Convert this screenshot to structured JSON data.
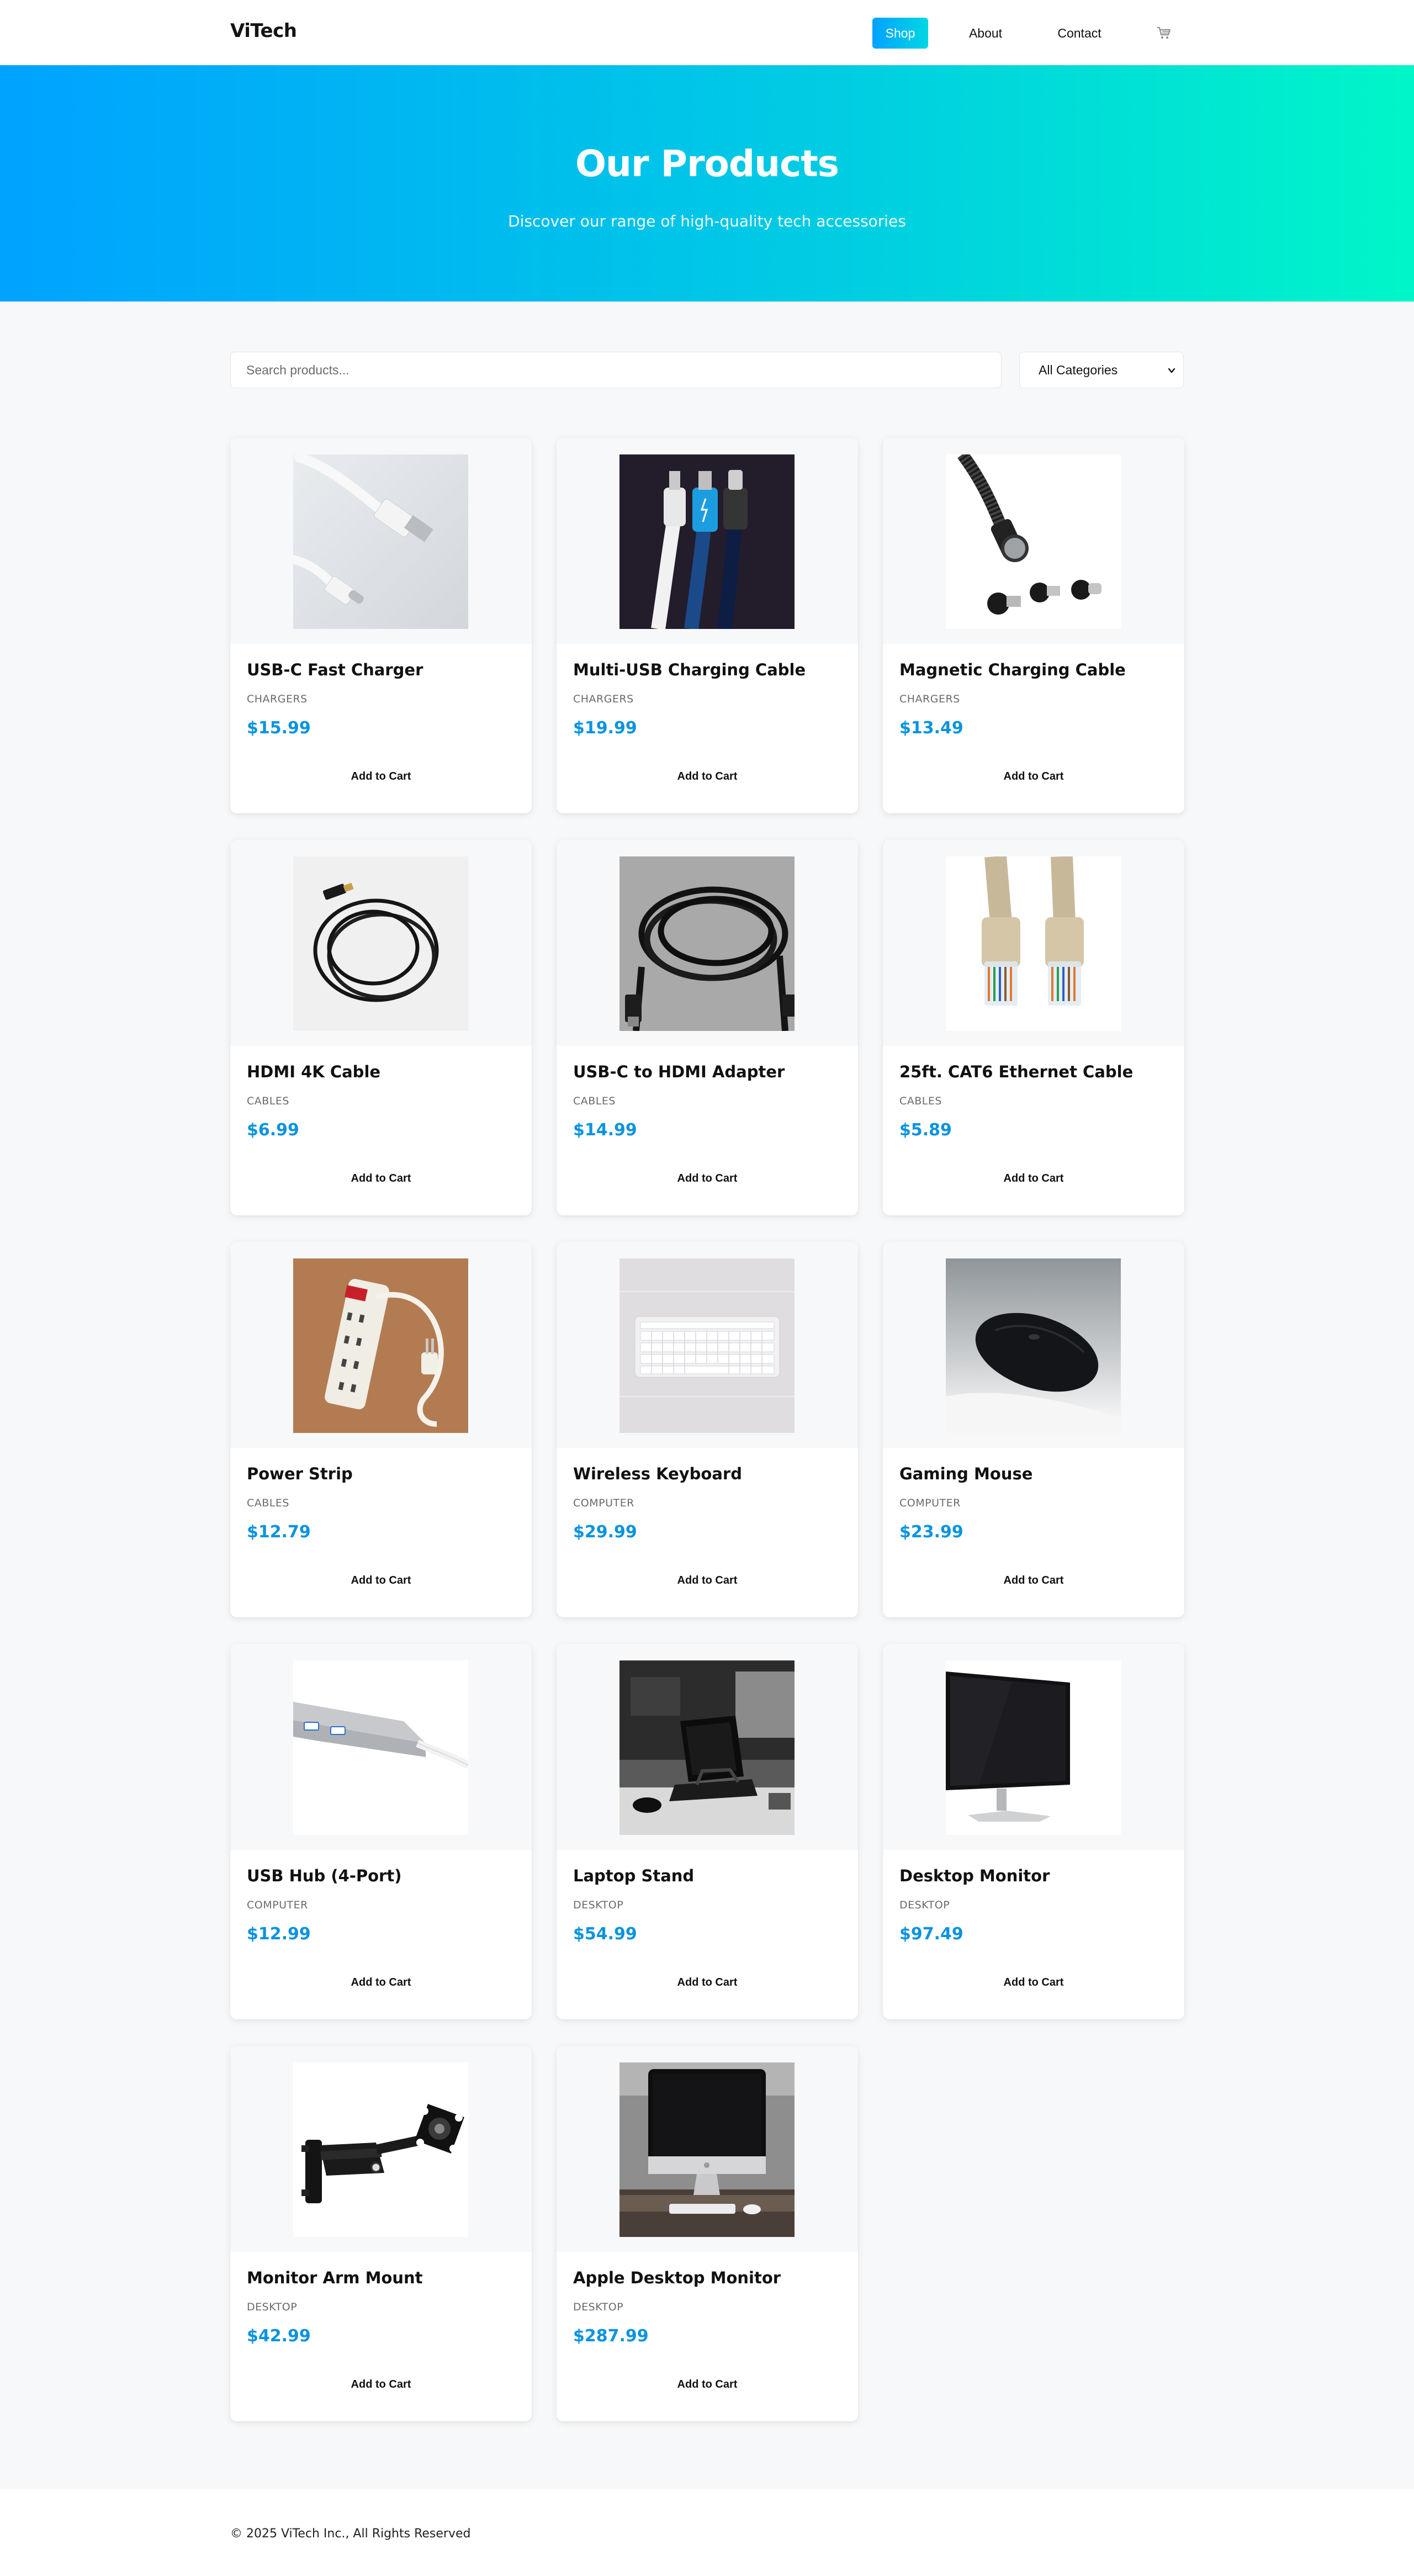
{
  "brand": {
    "logo": "ViTech"
  },
  "nav": {
    "items": [
      {
        "label": "Shop",
        "active": true
      },
      {
        "label": "About",
        "active": false
      },
      {
        "label": "Contact",
        "active": false
      }
    ],
    "cart_icon": "cart-icon"
  },
  "hero": {
    "title": "Our Products",
    "subtitle": "Discover our range of high-quality tech accessories"
  },
  "filters": {
    "search_placeholder": "Search products...",
    "category_selected": "All Categories"
  },
  "products": [
    {
      "name": "USB-C Fast Charger",
      "category": "CHARGERS",
      "price": "$15.99",
      "button": "Add to Cart",
      "image": "usb-c-cable"
    },
    {
      "name": "Multi-USB Charging Cable",
      "category": "CHARGERS",
      "price": "$19.99",
      "button": "Add to Cart",
      "image": "multi-usb-cable"
    },
    {
      "name": "Magnetic Charging Cable",
      "category": "CHARGERS",
      "price": "$13.49",
      "button": "Add to Cart",
      "image": "magnetic-cable"
    },
    {
      "name": "HDMI 4K Cable",
      "category": "CABLES",
      "price": "$6.99",
      "button": "Add to Cart",
      "image": "hdmi-cable"
    },
    {
      "name": "USB-C to HDMI Adapter",
      "category": "CABLES",
      "price": "$14.99",
      "button": "Add to Cart",
      "image": "coiled-cable"
    },
    {
      "name": "25ft. CAT6 Ethernet Cable",
      "category": "CABLES",
      "price": "$5.89",
      "button": "Add to Cart",
      "image": "ethernet-cable"
    },
    {
      "name": "Power Strip",
      "category": "CABLES",
      "price": "$12.79",
      "button": "Add to Cart",
      "image": "power-strip"
    },
    {
      "name": "Wireless Keyboard",
      "category": "COMPUTER",
      "price": "$29.99",
      "button": "Add to Cart",
      "image": "keyboard"
    },
    {
      "name": "Gaming Mouse",
      "category": "COMPUTER",
      "price": "$23.99",
      "button": "Add to Cart",
      "image": "mouse"
    },
    {
      "name": "USB Hub (4-Port)",
      "category": "COMPUTER",
      "price": "$12.99",
      "button": "Add to Cart",
      "image": "usb-hub"
    },
    {
      "name": "Laptop Stand",
      "category": "DESKTOP",
      "price": "$54.99",
      "button": "Add to Cart",
      "image": "laptop-stand"
    },
    {
      "name": "Desktop Monitor",
      "category": "DESKTOP",
      "price": "$97.49",
      "button": "Add to Cart",
      "image": "monitor"
    },
    {
      "name": "Monitor Arm Mount",
      "category": "DESKTOP",
      "price": "$42.99",
      "button": "Add to Cart",
      "image": "monitor-arm"
    },
    {
      "name": "Apple Desktop Monitor",
      "category": "DESKTOP",
      "price": "$287.99",
      "button": "Add to Cart",
      "image": "imac"
    }
  ],
  "colors": {
    "accent": "#0a93e0",
    "hero_gradient_start": "#00a3ff",
    "hero_gradient_end": "#00f6c8"
  },
  "footer": {
    "copyright": "© 2025 ViTech Inc., All Rights Reserved"
  }
}
